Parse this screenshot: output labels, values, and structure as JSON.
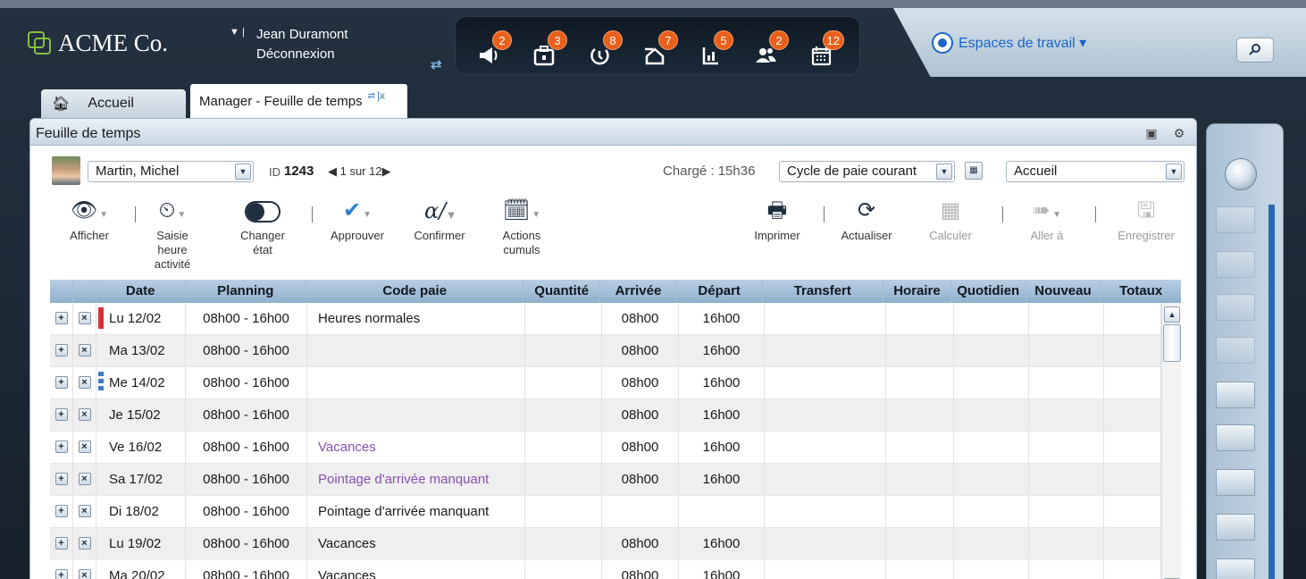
{
  "header": {
    "logo_text": "ACME Co.",
    "user_name": "Jean Duramont",
    "logout_label": "Déconnexion",
    "notifications": [
      {
        "icon": "megaphone-icon",
        "count": "2"
      },
      {
        "icon": "briefcase-icon",
        "count": "3"
      },
      {
        "icon": "clock-refresh-icon",
        "count": "8"
      },
      {
        "icon": "home-arrow-icon",
        "count": "7"
      },
      {
        "icon": "chart-icon",
        "count": "5"
      },
      {
        "icon": "users-icon",
        "count": "2"
      },
      {
        "icon": "calendar-icon",
        "count": "12"
      }
    ],
    "workspaces_label": "Espaces de travail ▾"
  },
  "tabs": {
    "home_label": "Accueil",
    "active_label": "Manager - Feuille de temps",
    "active_close": "x"
  },
  "panel": {
    "title": "Feuille de temps",
    "employee": "Martin, Michel",
    "id_label": "ID",
    "id_value": "1243",
    "pager": "1 sur 12",
    "charge": "Chargé : 15h36",
    "period": "Cycle de paie courant",
    "view": "Accueil"
  },
  "toolbar": [
    {
      "label": "Afficher",
      "icon": "eye-icon"
    },
    {
      "label": "Saisie heure activité",
      "icon": "time-entry-icon"
    },
    {
      "label": "Changer état",
      "icon": "toggle-icon"
    },
    {
      "label": "Approuver",
      "icon": "check-icon"
    },
    {
      "label": "Confirmer",
      "icon": "signature-icon"
    },
    {
      "label": "Actions cumuls",
      "icon": "calendar-stack-icon"
    },
    {
      "label": "Imprimer",
      "icon": "printer-icon"
    },
    {
      "label": "Actualiser",
      "icon": "refresh-icon"
    },
    {
      "label": "Calculer",
      "icon": "calculator-icon"
    },
    {
      "label": "Aller à",
      "icon": "goto-icon"
    },
    {
      "label": "Enregistrer",
      "icon": "save-icon"
    }
  ],
  "table": {
    "columns": [
      "Date",
      "Planning",
      "Code paie",
      "Quantité",
      "Arrivée",
      "Départ",
      "Transfert",
      "Horaire",
      "Quotidien",
      "Nouveau",
      "Totaux"
    ],
    "rows": [
      {
        "date": "Lu 12/02",
        "planning": "08h00 - 16h00",
        "code": "Heures normales",
        "arrivee": "08h00",
        "depart": "16h00"
      },
      {
        "date": "Ma 13/02",
        "planning": "08h00 - 16h00",
        "code": "",
        "arrivee": "08h00",
        "depart": "16h00"
      },
      {
        "date": "Me 14/02",
        "planning": "08h00 - 16h00",
        "code": "",
        "arrivee": "08h00",
        "depart": "16h00"
      },
      {
        "date": "Je 15/02",
        "planning": "08h00 - 16h00",
        "code": "",
        "arrivee": "08h00",
        "depart": "16h00"
      },
      {
        "date": "Ve 16/02",
        "planning": "08h00 - 16h00",
        "code": "Vacances",
        "arrivee": "08h00",
        "depart": "16h00"
      },
      {
        "date": "Sa 17/02",
        "planning": "08h00 - 16h00",
        "code": "Pointage d'arrivée manquant",
        "arrivee": "08h00",
        "depart": "16h00"
      },
      {
        "date": "Di 18/02",
        "planning": "08h00 - 16h00",
        "code": "Pointage d'arrivée manquant",
        "arrivee": "",
        "depart": ""
      },
      {
        "date": "Lu 19/02",
        "planning": "08h00 - 16h00",
        "code": "Vacances",
        "arrivee": "08h00",
        "depart": "16h00"
      },
      {
        "date": "Ma 20/02",
        "planning": "08h00 - 16h00",
        "code": "Vacances",
        "arrivee": "08h00",
        "depart": "16h00"
      }
    ]
  },
  "colors": {
    "accent": "#1c64c6",
    "badge": "#e8601c",
    "flag_red": "#d9303a",
    "flag_blue": "#3a7cc9",
    "code_purple": "#8a4fb0"
  }
}
